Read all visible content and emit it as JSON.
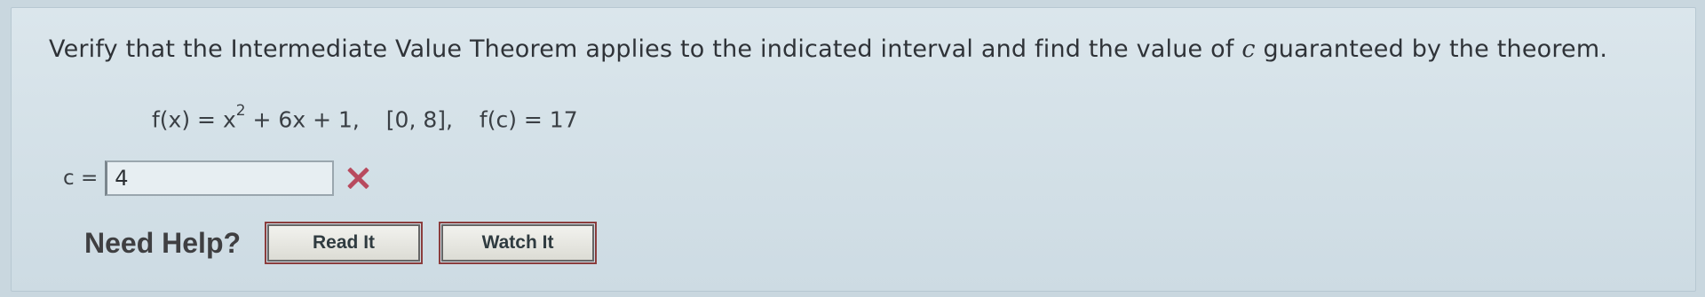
{
  "question": {
    "prefix": "Verify that the Intermediate Value Theorem applies to the indicated interval and find the value of ",
    "variable": "c",
    "suffix": " guaranteed by the theorem."
  },
  "equation": {
    "function": "f(x) = x",
    "exponent": "2",
    "function_rest": " + 6x + 1,",
    "interval": "[0, 8],",
    "condition": "f(c) = 17"
  },
  "answer": {
    "label": "c =",
    "value": "4",
    "status": "incorrect"
  },
  "help": {
    "label": "Need Help?",
    "read_label": "Read It",
    "watch_label": "Watch It"
  },
  "colors": {
    "background": "#c9d7df",
    "wrong_mark": "#b84a5e",
    "button_outline": "#8b3d3d"
  }
}
